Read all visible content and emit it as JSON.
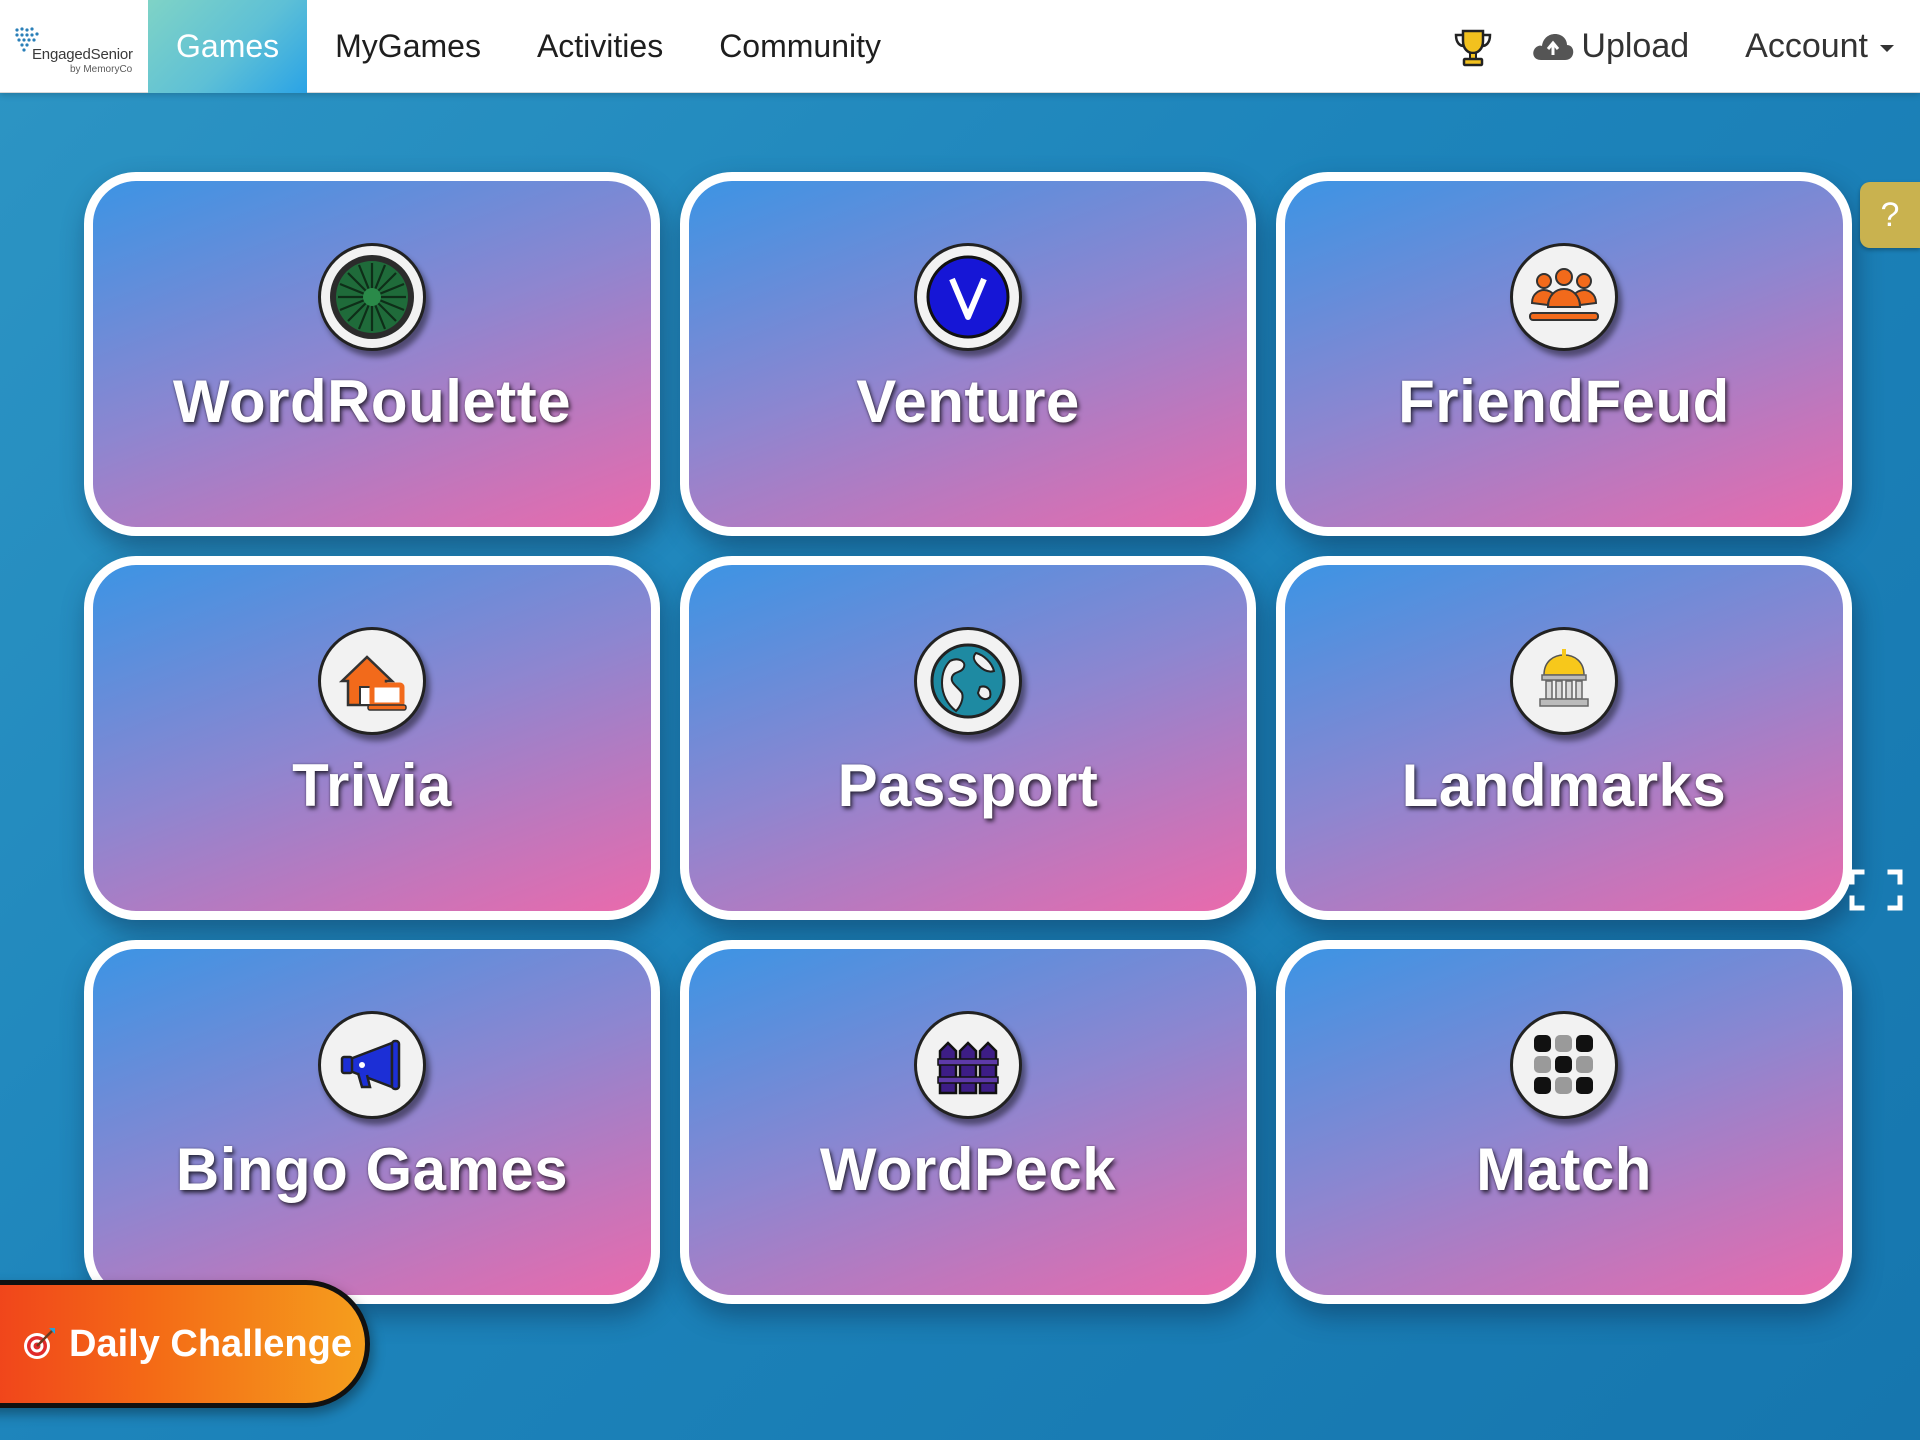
{
  "app": {
    "logo_text": "EngagedSenior",
    "logo_subtext": "by MemoryCo"
  },
  "nav": {
    "items": [
      {
        "label": "Games",
        "active": true
      },
      {
        "label": "MyGames",
        "active": false
      },
      {
        "label": "Activities",
        "active": false
      },
      {
        "label": "Community",
        "active": false
      }
    ],
    "upload_label": "Upload",
    "account_label": "Account"
  },
  "games": [
    {
      "title": "WordRoulette",
      "icon": "roulette-wheel-icon"
    },
    {
      "title": "Venture",
      "icon": "letter-v-icon"
    },
    {
      "title": "FriendFeud",
      "icon": "group-people-icon"
    },
    {
      "title": "Trivia",
      "icon": "house-laptop-icon"
    },
    {
      "title": "Passport",
      "icon": "globe-icon"
    },
    {
      "title": "Landmarks",
      "icon": "landmark-building-icon"
    },
    {
      "title": "Bingo Games",
      "icon": "megaphone-icon"
    },
    {
      "title": "WordPeck",
      "icon": "fence-icon"
    },
    {
      "title": "Match",
      "icon": "grid-squares-icon"
    }
  ],
  "help_label": "?",
  "daily_challenge_label": "Daily Challenge",
  "colors": {
    "nav_active": "#2aa3e6",
    "card_gradient_start": "#3c94e4",
    "card_gradient_end": "#ea6aac",
    "daily_challenge": "#f46a16",
    "help_button": "#c9b24f"
  }
}
